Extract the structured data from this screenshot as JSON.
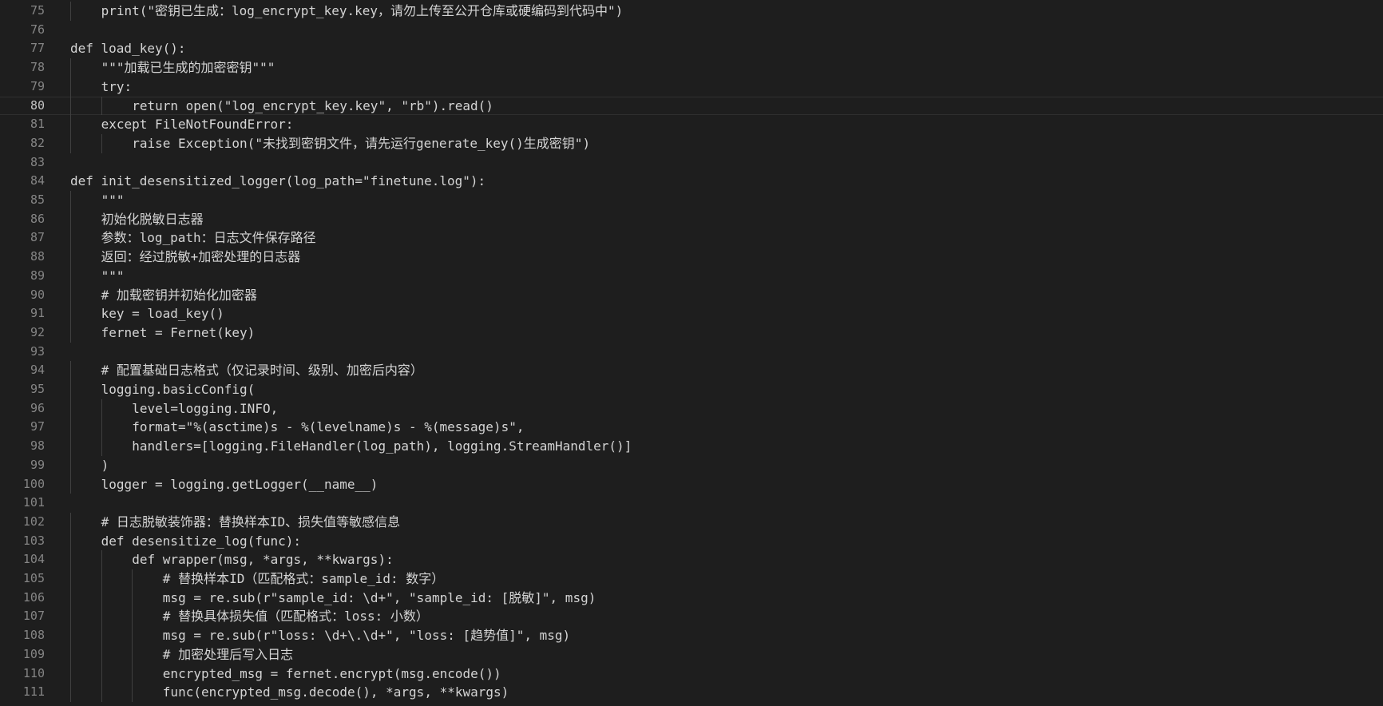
{
  "editor": {
    "current_line": "80",
    "lines": [
      {
        "n": "75",
        "indent": 1,
        "text": "print(\"密钥已生成：log_encrypt_key.key，请勿上传至公开仓库或硬编码到代码中\")"
      },
      {
        "n": "76",
        "indent": 0,
        "text": ""
      },
      {
        "n": "77",
        "indent": 0,
        "text": "def load_key():"
      },
      {
        "n": "78",
        "indent": 1,
        "text": "\"\"\"加载已生成的加密密钥\"\"\""
      },
      {
        "n": "79",
        "indent": 1,
        "text": "try:"
      },
      {
        "n": "80",
        "indent": 2,
        "text": "return open(\"log_encrypt_key.key\", \"rb\").read()"
      },
      {
        "n": "81",
        "indent": 1,
        "text": "except FileNotFoundError:"
      },
      {
        "n": "82",
        "indent": 2,
        "text": "raise Exception(\"未找到密钥文件，请先运行generate_key()生成密钥\")"
      },
      {
        "n": "83",
        "indent": 0,
        "text": ""
      },
      {
        "n": "84",
        "indent": 0,
        "text": "def init_desensitized_logger(log_path=\"finetune.log\"):"
      },
      {
        "n": "85",
        "indent": 1,
        "text": "\"\"\""
      },
      {
        "n": "86",
        "indent": 1,
        "text": "初始化脱敏日志器"
      },
      {
        "n": "87",
        "indent": 1,
        "text": "参数：log_path：日志文件保存路径"
      },
      {
        "n": "88",
        "indent": 1,
        "text": "返回：经过脱敏+加密处理的日志器"
      },
      {
        "n": "89",
        "indent": 1,
        "text": "\"\"\""
      },
      {
        "n": "90",
        "indent": 1,
        "text": "# 加载密钥并初始化加密器"
      },
      {
        "n": "91",
        "indent": 1,
        "text": "key = load_key()"
      },
      {
        "n": "92",
        "indent": 1,
        "text": "fernet = Fernet(key)"
      },
      {
        "n": "93",
        "indent": 0,
        "text": ""
      },
      {
        "n": "94",
        "indent": 1,
        "text": "# 配置基础日志格式（仅记录时间、级别、加密后内容）"
      },
      {
        "n": "95",
        "indent": 1,
        "text": "logging.basicConfig("
      },
      {
        "n": "96",
        "indent": 2,
        "text": "level=logging.INFO,"
      },
      {
        "n": "97",
        "indent": 2,
        "text": "format=\"%(asctime)s - %(levelname)s - %(message)s\","
      },
      {
        "n": "98",
        "indent": 2,
        "text": "handlers=[logging.FileHandler(log_path), logging.StreamHandler()]"
      },
      {
        "n": "99",
        "indent": 1,
        "text": ")"
      },
      {
        "n": "100",
        "indent": 1,
        "text": "logger = logging.getLogger(__name__)"
      },
      {
        "n": "101",
        "indent": 0,
        "text": ""
      },
      {
        "n": "102",
        "indent": 1,
        "text": "# 日志脱敏装饰器：替换样本ID、损失值等敏感信息"
      },
      {
        "n": "103",
        "indent": 1,
        "text": "def desensitize_log(func):"
      },
      {
        "n": "104",
        "indent": 2,
        "text": "def wrapper(msg, *args, **kwargs):"
      },
      {
        "n": "105",
        "indent": 3,
        "text": "# 替换样本ID（匹配格式：sample_id: 数字）"
      },
      {
        "n": "106",
        "indent": 3,
        "text": "msg = re.sub(r\"sample_id: \\d+\", \"sample_id: [脱敏]\", msg)"
      },
      {
        "n": "107",
        "indent": 3,
        "text": "# 替换具体损失值（匹配格式：loss: 小数）"
      },
      {
        "n": "108",
        "indent": 3,
        "text": "msg = re.sub(r\"loss: \\d+\\.\\d+\", \"loss: [趋势值]\", msg)"
      },
      {
        "n": "109",
        "indent": 3,
        "text": "# 加密处理后写入日志"
      },
      {
        "n": "110",
        "indent": 3,
        "text": "encrypted_msg = fernet.encrypt(msg.encode())"
      },
      {
        "n": "111",
        "indent": 3,
        "text": "func(encrypted_msg.decode(), *args, **kwargs)"
      }
    ]
  }
}
